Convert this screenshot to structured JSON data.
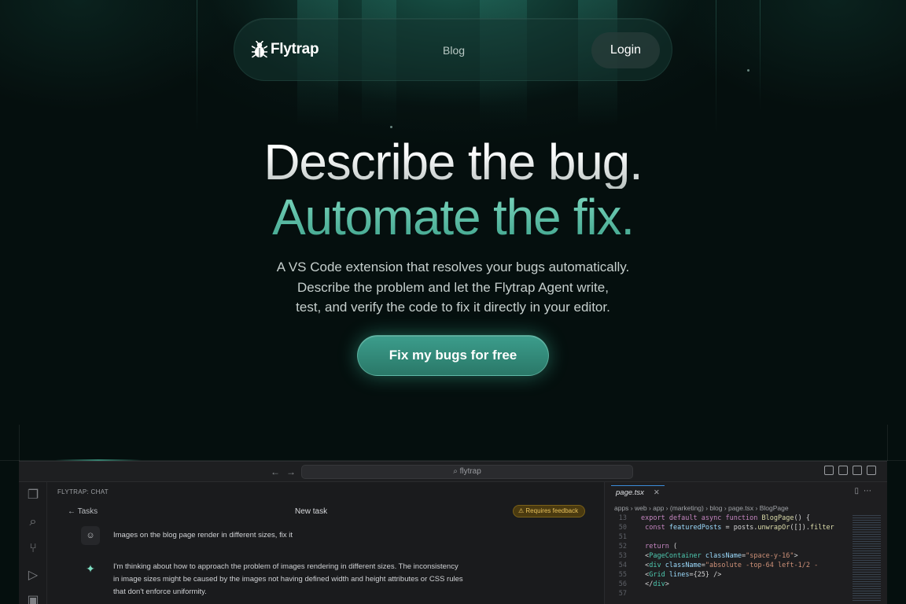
{
  "nav": {
    "brand": "Flytrap",
    "links": [
      "Blog"
    ],
    "login_label": "Login"
  },
  "hero": {
    "headline_line1": "Describe the bug.",
    "headline_line2": "Automate the fix.",
    "subtitle_lines": [
      "A VS Code extension that resolves your bugs automatically.",
      "Describe the problem and let the Flytrap Agent write,",
      "test, and verify the code to fix it directly in your editor."
    ],
    "cta_label": "Fix my bugs for free"
  },
  "colors": {
    "accent": "#3c9d8c",
    "headline_accent": "#6fcfb5",
    "background": "#050f0e"
  },
  "editor": {
    "command_search": "flytrap",
    "chat": {
      "header": "FLYTRAP: CHAT",
      "back_label": "Tasks",
      "title": "New task",
      "feedback_badge": "Requires feedback",
      "messages": [
        {
          "role": "user",
          "icon": "user-icon",
          "text": "Images on the blog page render in different sizes, fix it"
        },
        {
          "role": "agent",
          "icon": "sparkle-icon",
          "lines": [
            "I'm thinking about how to approach the problem of images rendering in different sizes. The inconsistency",
            "in image sizes might be caused by the images not having defined width and height attributes or CSS rules",
            "that don't enforce uniformity."
          ]
        }
      ]
    },
    "code": {
      "tab_name": "page.tsx",
      "breadcrumbs": "apps › web › app › (marketing) › blog › page.tsx › BlogPage",
      "lines": [
        {
          "n": "13",
          "t": "export default async function BlogPage() {"
        },
        {
          "n": "50",
          "t": "  const featuredPosts = posts.unwrapOr([]).filter"
        },
        {
          "n": "51",
          "t": ""
        },
        {
          "n": "52",
          "t": "  return ("
        },
        {
          "n": "53",
          "t": "    <PageContainer className=\"space-y-16\">"
        },
        {
          "n": "54",
          "t": "      <div className=\"absolute -top-64 left-1/2 -"
        },
        {
          "n": "55",
          "t": "        <Grid lines={25} />"
        },
        {
          "n": "56",
          "t": "      </div>"
        },
        {
          "n": "57",
          "t": ""
        }
      ]
    }
  }
}
